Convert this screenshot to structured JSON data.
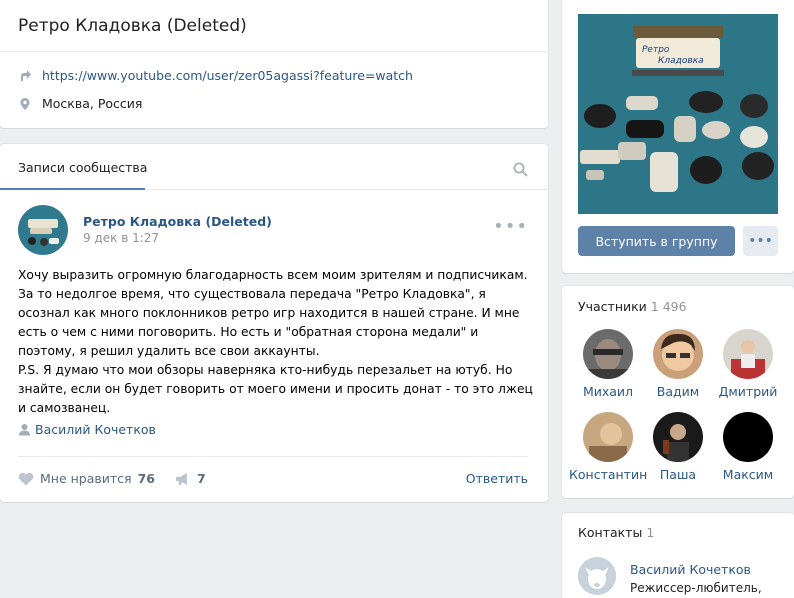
{
  "group": {
    "title": "Ретро Кладовка (Deleted)",
    "link": "https://www.youtube.com/user/zer05agassi?feature=watch",
    "location": "Москва, Россия"
  },
  "cover": {
    "logo_line1": "Ретро",
    "logo_line2": "Кладовка"
  },
  "wall": {
    "tab": "Записи сообщества",
    "post": {
      "author": "Ретро Кладовка (Deleted)",
      "date": "9 дек в 1:27",
      "text_p1": "Хочу выразить огромную благодарность всем моим зрителям и подписчикам. За то недолгое время, что существовала передача \"Ретро Кладовка\", я осознал как много поклонников ретро игр находится в нашей стране. И мне есть о чем с ними поговорить. Но есть и \"обратная сторона медали\" и поэтому, я решил удалить все свои аккаунты.",
      "text_p2": "P.S. Я думаю что мои обзоры наверняка кто-нибудь перезальет на ютуб. Но знайте, если он будет говорить от моего имени и просить донат - то это лжец и самозванец.",
      "signer": "Василий Кочетков",
      "like_label": "Мне нравится",
      "like_count": "76",
      "share_count": "7",
      "reply_label": "Ответить"
    }
  },
  "actions": {
    "join_label": "Вступить в группу",
    "more_label": "•••"
  },
  "members": {
    "label": "Участники",
    "count": "1 496",
    "list": [
      {
        "name": "Михаил"
      },
      {
        "name": "Вадим"
      },
      {
        "name": "Дмитрий"
      },
      {
        "name": "Константин"
      },
      {
        "name": "Паша"
      },
      {
        "name": "Максим"
      }
    ]
  },
  "contacts": {
    "label": "Контакты",
    "count": "1",
    "person": {
      "name": "Василий Кочетков",
      "role": "Режиссер-любитель,"
    }
  },
  "colors": {
    "accent": "#5181b8",
    "link": "#2a5885",
    "button": "#5e81a8",
    "background": "#edeef0"
  }
}
